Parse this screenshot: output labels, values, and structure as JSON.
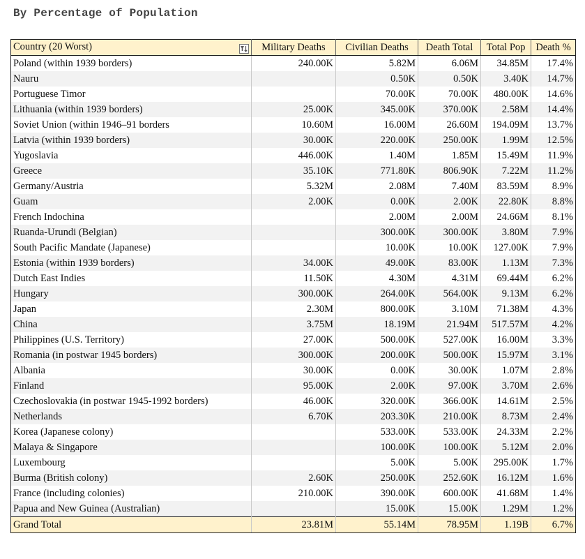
{
  "title": "By Percentage of Population",
  "table": {
    "columns": [
      "Country (20 Worst)",
      "Military Deaths",
      "Civilian Deaths",
      "Death Total",
      "Total Pop",
      "Death %"
    ],
    "rows": [
      [
        "Poland (within 1939 borders)",
        "240.00K",
        "5.82M",
        "6.06M",
        "34.85M",
        "17.4%"
      ],
      [
        "Nauru",
        "",
        "0.50K",
        "0.50K",
        "3.40K",
        "14.7%"
      ],
      [
        "Portuguese Timor",
        "",
        "70.00K",
        "70.00K",
        "480.00K",
        "14.6%"
      ],
      [
        "Lithuania (within 1939 borders)",
        "25.00K",
        "345.00K",
        "370.00K",
        "2.58M",
        "14.4%"
      ],
      [
        "Soviet Union (within 1946–91 borders",
        "10.60M",
        "16.00M",
        "26.60M",
        "194.09M",
        "13.7%"
      ],
      [
        "Latvia (within 1939 borders)",
        "30.00K",
        "220.00K",
        "250.00K",
        "1.99M",
        "12.5%"
      ],
      [
        "Yugoslavia",
        "446.00K",
        "1.40M",
        "1.85M",
        "15.49M",
        "11.9%"
      ],
      [
        "Greece",
        "35.10K",
        "771.80K",
        "806.90K",
        "7.22M",
        "11.2%"
      ],
      [
        "Germany/Austria",
        "5.32M",
        "2.08M",
        "7.40M",
        "83.59M",
        "8.9%"
      ],
      [
        "Guam",
        "2.00K",
        "0.00K",
        "2.00K",
        "22.80K",
        "8.8%"
      ],
      [
        "French Indochina",
        "",
        "2.00M",
        "2.00M",
        "24.66M",
        "8.1%"
      ],
      [
        "Ruanda-Urundi (Belgian)",
        "",
        "300.00K",
        "300.00K",
        "3.80M",
        "7.9%"
      ],
      [
        "South Pacific Mandate (Japanese)",
        "",
        "10.00K",
        "10.00K",
        "127.00K",
        "7.9%"
      ],
      [
        "Estonia (within 1939 borders)",
        "34.00K",
        "49.00K",
        "83.00K",
        "1.13M",
        "7.3%"
      ],
      [
        "Dutch East Indies",
        "11.50K",
        "4.30M",
        "4.31M",
        "69.44M",
        "6.2%"
      ],
      [
        "Hungary",
        "300.00K",
        "264.00K",
        "564.00K",
        "9.13M",
        "6.2%"
      ],
      [
        "Japan",
        "2.30M",
        "800.00K",
        "3.10M",
        "71.38M",
        "4.3%"
      ],
      [
        "China",
        "3.75M",
        "18.19M",
        "21.94M",
        "517.57M",
        "4.2%"
      ],
      [
        "Philippines (U.S. Territory)",
        "27.00K",
        "500.00K",
        "527.00K",
        "16.00M",
        "3.3%"
      ],
      [
        "Romania (in postwar 1945 borders)",
        "300.00K",
        "200.00K",
        "500.00K",
        "15.97M",
        "3.1%"
      ],
      [
        "Albania",
        "30.00K",
        "0.00K",
        "30.00K",
        "1.07M",
        "2.8%"
      ],
      [
        "Finland",
        "95.00K",
        "2.00K",
        "97.00K",
        "3.70M",
        "2.6%"
      ],
      [
        "Czechoslovakia (in postwar 1945-1992 borders)",
        "46.00K",
        "320.00K",
        "366.00K",
        "14.61M",
        "2.5%"
      ],
      [
        "Netherlands",
        "6.70K",
        "203.30K",
        "210.00K",
        "8.73M",
        "2.4%"
      ],
      [
        "Korea (Japanese colony)",
        "",
        "533.00K",
        "533.00K",
        "24.33M",
        "2.2%"
      ],
      [
        "Malaya & Singapore",
        "",
        "100.00K",
        "100.00K",
        "5.12M",
        "2.0%"
      ],
      [
        "Luxembourg",
        "",
        "5.00K",
        "5.00K",
        "295.00K",
        "1.7%"
      ],
      [
        "Burma (British colony)",
        "2.60K",
        "250.00K",
        "252.60K",
        "16.12M",
        "1.6%"
      ],
      [
        "France (including colonies)",
        "210.00K",
        "390.00K",
        "600.00K",
        "41.68M",
        "1.4%"
      ],
      [
        "Papua and New Guinea (Australian)",
        "",
        "15.00K",
        "15.00K",
        "1.29M",
        "1.2%"
      ]
    ],
    "total": [
      "Grand Total",
      "23.81M",
      "55.14M",
      "78.95M",
      "1.19B",
      "6.7%"
    ]
  },
  "icons": {
    "header_filter": "filter-sort-icon"
  },
  "colors": {
    "header_bg": "#fff2cc",
    "zebra": "#f2f2f2"
  }
}
